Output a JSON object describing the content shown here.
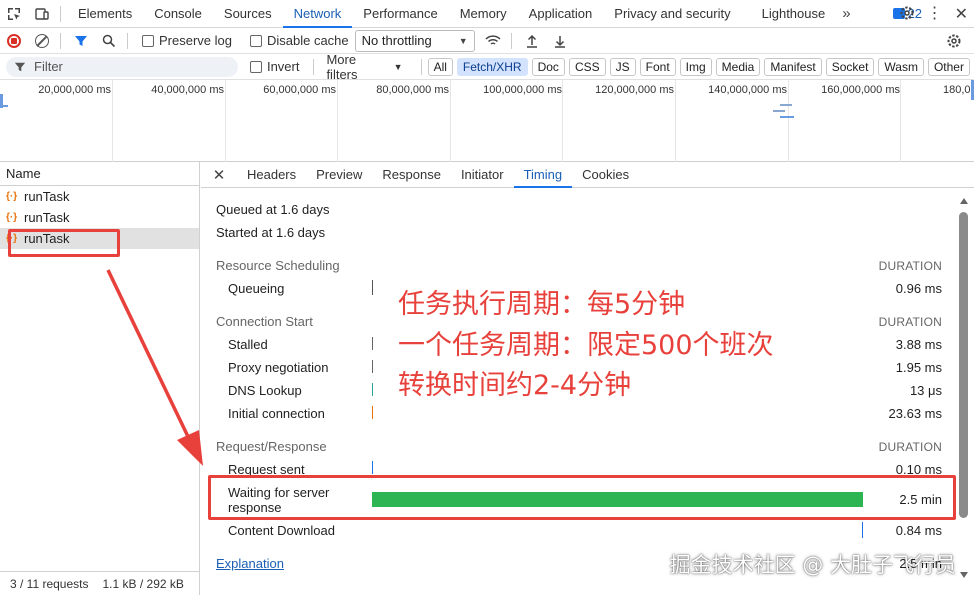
{
  "tabs": [
    "Elements",
    "Console",
    "Sources",
    "Network",
    "Performance",
    "Memory",
    "Application",
    "Privacy and security",
    "Lighthouse"
  ],
  "active_tab": "Network",
  "issues_count": "22",
  "toolbar": {
    "preserve_log": "Preserve log",
    "disable_cache": "Disable cache",
    "throttling": "No throttling"
  },
  "filter": {
    "placeholder": "Filter",
    "invert": "Invert",
    "more_filters": "More filters",
    "types": [
      "All",
      "Fetch/XHR",
      "Doc",
      "CSS",
      "JS",
      "Font",
      "Img",
      "Media",
      "Manifest",
      "Socket",
      "Wasm",
      "Other"
    ],
    "active_type": "Fetch/XHR"
  },
  "overview": {
    "ticks": [
      "20,000,000 ms",
      "40,000,000 ms",
      "60,000,000 ms",
      "80,000,000 ms",
      "100,000,000 ms",
      "120,000,000 ms",
      "140,000,000 ms",
      "160,000,000 ms",
      "180,0"
    ]
  },
  "requests": {
    "header": "Name",
    "items": [
      "runTask",
      "runTask",
      "runTask"
    ],
    "selected_index": 2,
    "status_count": "3 / 11 requests",
    "status_size": "1.1 kB / 292 kB"
  },
  "detail": {
    "tabs": [
      "Headers",
      "Preview",
      "Response",
      "Initiator",
      "Timing",
      "Cookies"
    ],
    "active_tab": "Timing",
    "queued": "Queued at 1.6 days",
    "started": "Started at 1.6 days",
    "duration_label": "DURATION",
    "sections": {
      "scheduling": "Resource Scheduling",
      "connection": "Connection Start",
      "reqres": "Request/Response"
    },
    "rows": {
      "queueing": {
        "label": "Queueing",
        "value": "0.96 ms"
      },
      "stalled": {
        "label": "Stalled",
        "value": "3.88 ms"
      },
      "proxy": {
        "label": "Proxy negotiation",
        "value": "1.95 ms"
      },
      "dns": {
        "label": "DNS Lookup",
        "value": "13 μs"
      },
      "initial": {
        "label": "Initial connection",
        "value": "23.63 ms"
      },
      "sent": {
        "label": "Request sent",
        "value": "0.10 ms"
      },
      "waiting_1": "Waiting for server",
      "waiting_2": "response",
      "waiting_value": "2.5 min",
      "download": {
        "label": "Content Download",
        "value": "0.84 ms"
      }
    },
    "explanation": "Explanation",
    "total_partial": "2.5 min"
  },
  "annotation": {
    "line1": "任务执行周期：每5分钟",
    "line2": "一个任务周期：限定500个班次",
    "line3": "转换时间约2-4分钟",
    "color": "#e8413c"
  },
  "watermark": "掘金技术社区 @ 大肚子飞行员",
  "colors": {
    "waiting_bar": "#2db553",
    "accent": "#1a73e8"
  }
}
